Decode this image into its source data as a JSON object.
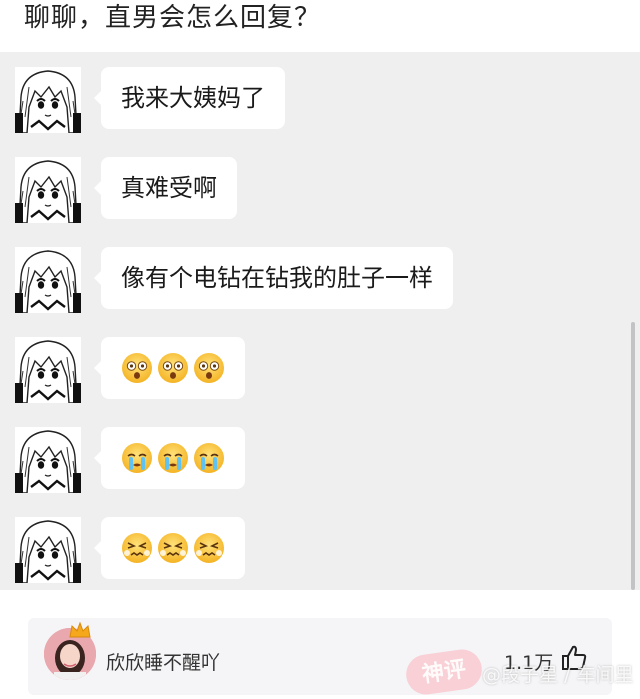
{
  "header": {
    "title": "聊聊，直男会怎么回复？"
  },
  "chat": {
    "messages": [
      {
        "type": "text",
        "text": "我来大姨妈了"
      },
      {
        "type": "text",
        "text": "真难受啊"
      },
      {
        "type": "text",
        "text": "像有个电钻在钻我的肚子一样"
      },
      {
        "type": "emoji",
        "emoji": "dizzy-face-icon",
        "count": 3
      },
      {
        "type": "emoji",
        "emoji": "crying-face-icon",
        "count": 3
      },
      {
        "type": "emoji",
        "emoji": "confounded-face-icon",
        "count": 3
      }
    ],
    "background": "#efeff0"
  },
  "comment": {
    "username": "欣欣睡不醒吖",
    "likes": "1.1万",
    "like_icon": "thumbs-up-icon",
    "avatar_badge_icon": "crown-icon"
  },
  "watermark": {
    "logo": "神评",
    "text": "@段子星 / 车间里"
  }
}
